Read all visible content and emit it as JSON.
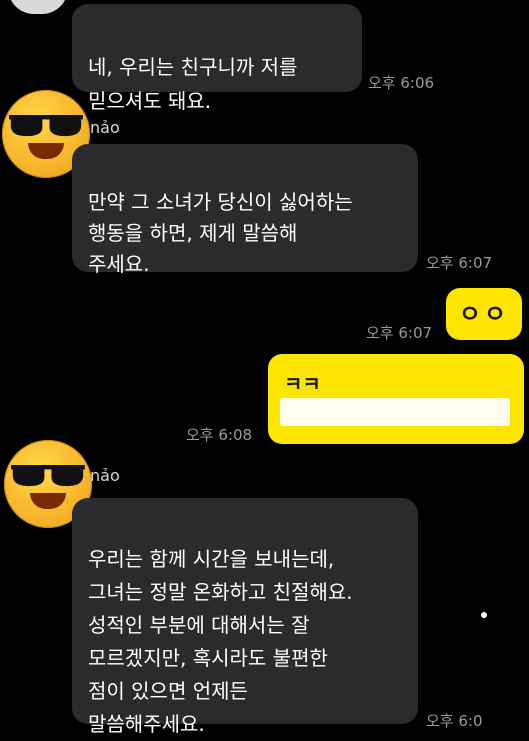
{
  "messages": {
    "m1": {
      "text": "네, 우리는 친구니까 저를\n믿으셔도 돼요.",
      "time": "오후 6:06"
    },
    "m2": {
      "sender": "nảo",
      "text": "만약 그 소녀가 당신이 싫어하는\n행동을 하면, 제게 말씀해\n주세요.",
      "time": "오후 6:07"
    },
    "m3": {
      "text": "ㅇㅇ",
      "time": "오후 6:07"
    },
    "m4": {
      "text": "ㅋㅋ",
      "time": "오후 6:08"
    },
    "m5": {
      "sender": "nảo",
      "text": "우리는 함께 시간을 보내는데,\n그녀는 정말 온화하고 친절해요.\n성적인 부분에 대해서는 잘\n모르겠지만, 혹시라도 불편한\n점이 있으면 언제든\n말씀해주세요.",
      "time": "오후 6:0"
    }
  },
  "avatar_icon": "sunglasses-emoji-icon",
  "colors": {
    "background": "#000000",
    "incoming_bubble": "#2b2b2e",
    "outgoing_bubble": "#fee500",
    "timestamp": "#9a9a9a"
  }
}
